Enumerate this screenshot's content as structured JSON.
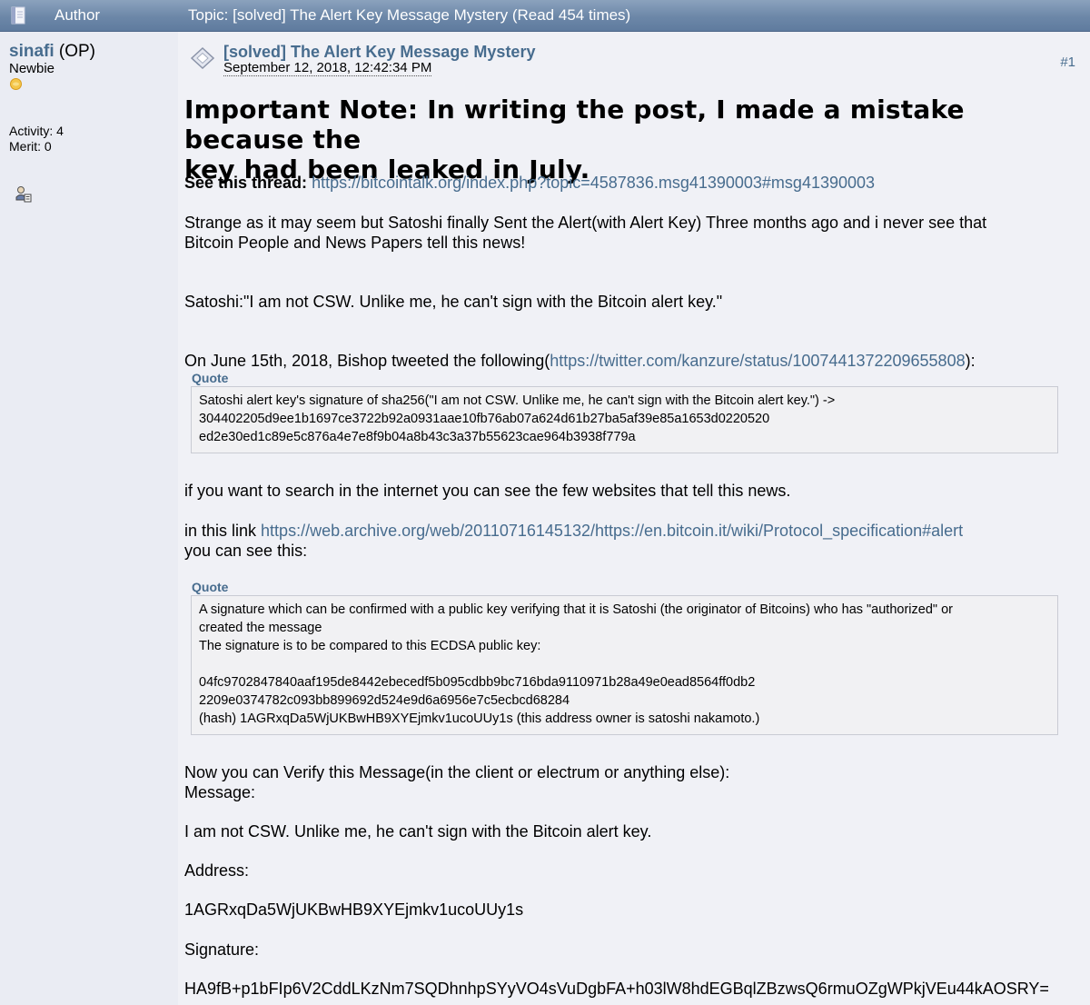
{
  "header": {
    "author_label": "Author",
    "topic_label": "Topic: [solved] The Alert Key Message Mystery  (Read 454 times)"
  },
  "poster": {
    "name": "sinafi",
    "op_tag": " (OP)",
    "rank": "Newbie",
    "activity": "Activity: 4",
    "merit": "Merit: 0"
  },
  "post": {
    "subject": "[solved] The Alert Key Message Mystery",
    "date": "September 12, 2018, 12:42:34 PM",
    "number": "#1",
    "note_line1": "Important Note: In writing the post, I made a mistake because the",
    "note_line2": "key had been leaked in July.",
    "see_thread_label": "See this thread:",
    "see_thread_link": "https://bitcointalk.org/index.php?topic=4587836.msg41390003#msg41390003",
    "para1_line1": "Strange as it may seem but Satoshi finally Sent the Alert(with Alert Key) Three months ago and i never see that",
    "para1_line2": "Bitcoin People and News Papers tell this news!",
    "satoshi_quote": "Satoshi:\"I am not CSW. Unlike me, he can't sign with the Bitcoin alert key.\"",
    "bishop_prefix": "On June 15th, 2018, Bishop tweeted the following(",
    "bishop_link": "https://twitter.com/kanzure/status/1007441372209655808",
    "bishop_suffix": "):",
    "quote_label": "Quote",
    "quote1": [
      "Satoshi alert key's signature of sha256(\"I am not CSW. Unlike me, he can't sign with the Bitcoin alert key.\") ->",
      "304402205d9ee1b1697ce3722b92a0931aae10fb76ab07a624d61b27ba5af39e85a1653d0220520",
      "ed2e30ed1c89e5c876a4e7e8f9b04a8b43c3a37b55623cae964b3938f779a"
    ],
    "search_text": "if you want to search in the internet you can see the few websites that tell this news.",
    "link_prefix": "in this link ",
    "archive_link": "https://web.archive.org/web/20110716145132/https://en.bitcoin.it/wiki/Protocol_specification#alert",
    "see_this": "you can see this:",
    "quote2": [
      "A signature which can be confirmed with a public key verifying that it is Satoshi (the originator of Bitcoins) who has \"authorized\" or",
      "created the message",
      "The signature is to be compared to this ECDSA public key:",
      "",
      "04fc9702847840aaf195de8442ebecedf5b095cdbb9bc716bda9110971b28a49e0ead8564ff0db2",
      "2209e0374782c093bb899692d524e9d6a6956e7c5ecbcd68284",
      "(hash) 1AGRxqDa5WjUKBwHB9XYEjmkv1ucoUUy1s (this address owner is satoshi nakamoto.)"
    ],
    "verify_text": "Now you can Verify this Message(in the client or electrum or anything else):",
    "message_label": "Message:",
    "message_value": "I am not CSW. Unlike me, he can't sign with the Bitcoin alert key.",
    "address_label": "Address:",
    "address_value": "1AGRxqDa5WjUKBwHB9XYEjmkv1ucoUUy1s",
    "signature_label": "Signature:",
    "signature_value": "HA9fB+p1bFIp6V2CddLKzNm7SQDhnhpSYyVO4sVuDgbFA+h03lW8hdEGBqlZBzwsQ6rmuOZgWPkjVEu44kAOSRY="
  }
}
